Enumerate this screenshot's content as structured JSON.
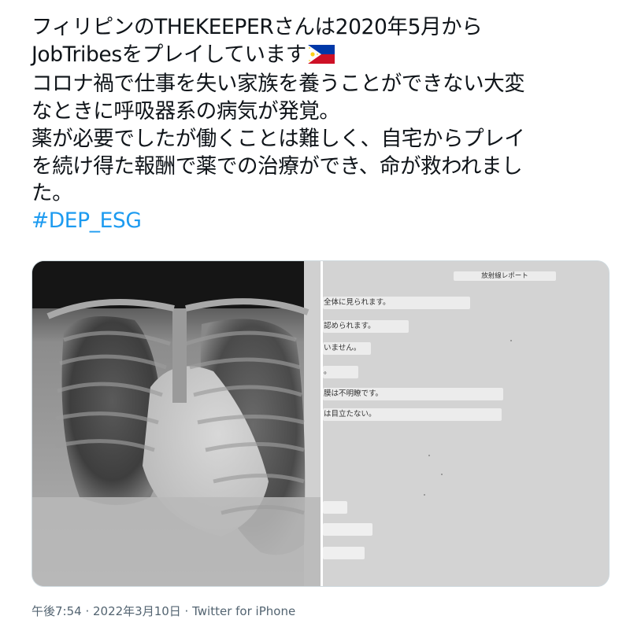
{
  "tweet": {
    "lines": [
      "フィリピンのTHEKEEPERさんは2020年5月から",
      "JobTribesをプレイしています",
      "コロナ禍で仕事を失い家族を養うことができない大変",
      "なときに呼吸器系の病気が発覚。",
      "薬が必要でしたが働くことは難しく、自宅からプレイ",
      "を続け得た報酬で薬での治療ができ、命が救われまし",
      "た。"
    ],
    "hashtag": "#DEP_ESG",
    "flag_icon": "philippines-flag-icon"
  },
  "media": {
    "report_title": "放射線レポート",
    "report_lines": [
      "全体に見られます。",
      "認められます。",
      "いません。",
      "。",
      "膜は不明瞭です。",
      "は目立たない。"
    ]
  },
  "meta": {
    "timestamp": "午後7:54 · 2022年3月10日 · ",
    "source": "Twitter for iPhone"
  },
  "colors": {
    "text": "#0f1419",
    "link": "#1d9bf0",
    "meta": "#536471",
    "border": "#cfd9de"
  }
}
